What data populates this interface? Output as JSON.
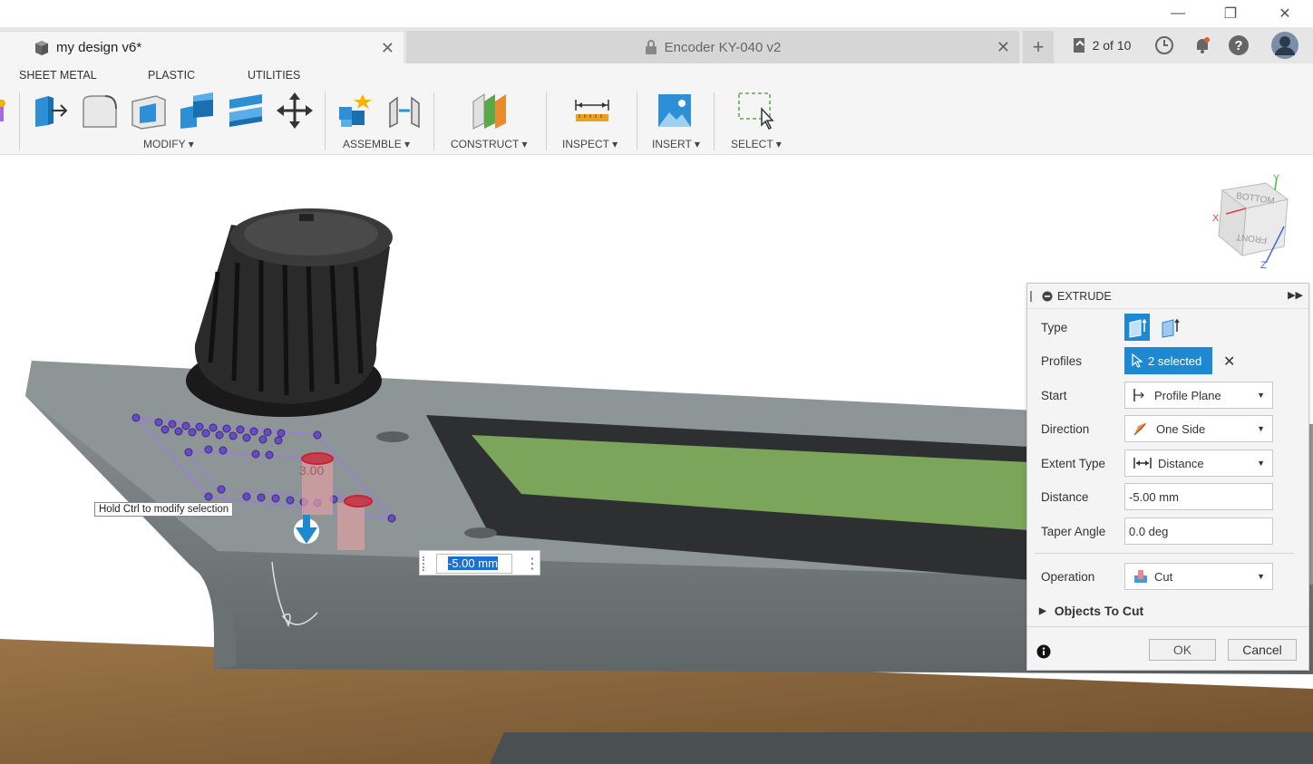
{
  "window": {
    "minimize": "—",
    "restore": "❐",
    "close": "✕"
  },
  "tabs": [
    {
      "label": "my design v6*",
      "close": "✕"
    },
    {
      "label": "Encoder KY-040 v2",
      "close": "✕"
    }
  ],
  "tab_actions": {
    "new_tab": "+",
    "job_count": "2 of 10"
  },
  "ribbon": {
    "tabs": [
      "SHEET METAL",
      "PLASTIC",
      "UTILITIES"
    ],
    "groups": {
      "modify": "MODIFY ▾",
      "assemble": "ASSEMBLE ▾",
      "construct": "CONSTRUCT ▾",
      "inspect": "INSPECT ▾",
      "insert": "INSERT ▾",
      "select": "SELECT ▾"
    }
  },
  "viewport": {
    "tooltip": "Hold Ctrl to modify selection",
    "distance_input": "-5.00 mm",
    "sketch_dim": "3.00",
    "viewcube": {
      "top": "BOTTOM",
      "front": "FRONT",
      "x_axis": "X",
      "y_axis": "Y",
      "z_axis": "Z"
    }
  },
  "extrude": {
    "title": "EXTRUDE",
    "labels": {
      "type": "Type",
      "profiles": "Profiles",
      "start": "Start",
      "direction": "Direction",
      "extent_type": "Extent Type",
      "distance": "Distance",
      "taper_angle": "Taper Angle",
      "operation": "Operation",
      "objects_to_cut": "Objects To Cut"
    },
    "values": {
      "profiles": "2 selected",
      "start": "Profile Plane",
      "direction": "One Side",
      "extent_type": "Distance",
      "distance": "-5.00 mm",
      "taper_angle": "0.0 deg",
      "operation": "Cut"
    },
    "buttons": {
      "ok": "OK",
      "cancel": "Cancel"
    }
  },
  "colors": {
    "accent": "#1e88d0",
    "selection_purple": "#7b4fd0",
    "lcd_green": "#7aa55a",
    "plate_gray": "#8e9596"
  }
}
